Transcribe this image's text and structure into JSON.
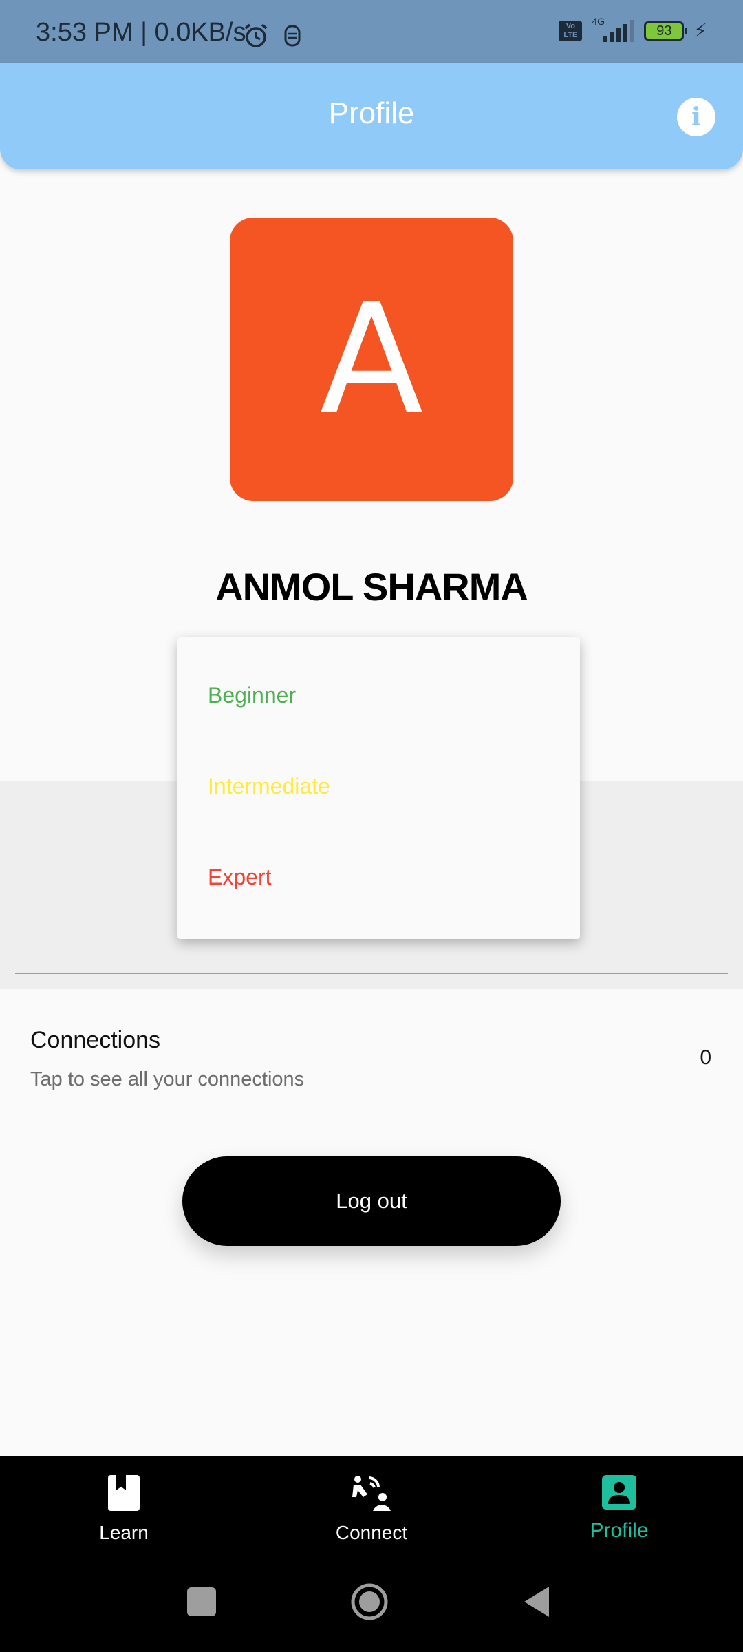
{
  "status_bar": {
    "time_text": "3:53 PM | 0.0KB/s",
    "volte": "Vo LTE",
    "network": "4G",
    "battery_level": "93",
    "icons": [
      "alarm-icon",
      "notification-icon",
      "signal-icon",
      "battery-icon",
      "charging-icon"
    ]
  },
  "header": {
    "title": "Profile",
    "info_icon": "i"
  },
  "profile": {
    "avatar_letter": "A",
    "avatar_color": "#f55523",
    "name": "ANMOL SHARMA"
  },
  "level_menu": {
    "options": [
      {
        "label": "Beginner",
        "color": "#4caf50"
      },
      {
        "label": "Intermediate",
        "color": "#ffeb3b"
      },
      {
        "label": "Expert",
        "color": "#f44336"
      }
    ]
  },
  "connections": {
    "title": "Connections",
    "subtitle": "Tap to see all your connections",
    "count": "0"
  },
  "actions": {
    "logout_label": "Log out"
  },
  "bottom_nav": {
    "items": [
      {
        "label": "Learn",
        "icon": "book-icon",
        "active": false
      },
      {
        "label": "Connect",
        "icon": "connect-icon",
        "active": false
      },
      {
        "label": "Profile",
        "icon": "profile-icon",
        "active": true
      }
    ],
    "active_color": "#1dbf9d"
  },
  "system_nav": {
    "icons": [
      "recents-icon",
      "home-icon",
      "back-icon"
    ]
  }
}
